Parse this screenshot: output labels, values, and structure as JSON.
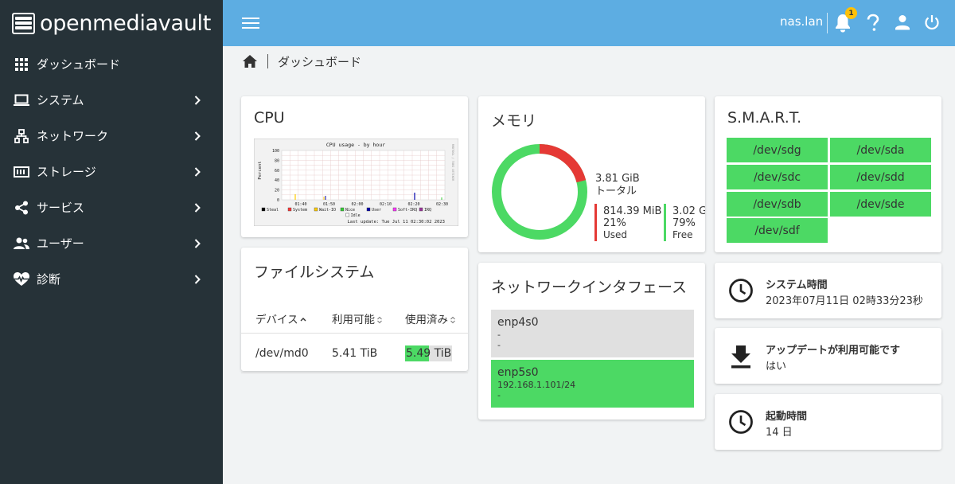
{
  "brand": {
    "name": "openmediavault"
  },
  "sidebar": {
    "items": [
      {
        "label": "ダッシュボード",
        "icon": "grid-icon"
      },
      {
        "label": "システム",
        "icon": "laptop-icon"
      },
      {
        "label": "ネットワーク",
        "icon": "network-icon"
      },
      {
        "label": "ストレージ",
        "icon": "storage-icon"
      },
      {
        "label": "サービス",
        "icon": "share-icon"
      },
      {
        "label": "ユーザー",
        "icon": "users-icon"
      },
      {
        "label": "診断",
        "icon": "heart-pulse-icon"
      }
    ]
  },
  "header": {
    "hostname": "nas.lan",
    "notification_count": "1"
  },
  "breadcrumb": {
    "current": "ダッシュボード"
  },
  "cpu": {
    "title": "CPU",
    "graph": {
      "title": "CPU usage - by hour",
      "ylabel": "Percent",
      "y_ticks": [
        "100",
        "80",
        "60",
        "40",
        "20",
        "0"
      ],
      "x_ticks": [
        "01:40",
        "01:50",
        "02:00",
        "02:10",
        "02:20",
        "02:30"
      ],
      "legend": [
        "Steal",
        "System",
        "Wait-IO",
        "Nice",
        "User",
        "Soft-IRQ",
        "IRQ",
        "Idle"
      ],
      "legend_colors": [
        "#000000",
        "#ff3333",
        "#ffcc00",
        "#33cc33",
        "#0000aa",
        "#ff33ff",
        "#993399",
        "#ffffff"
      ],
      "last_update": "Last update: Tue Jul 11 02:30:02 2023",
      "side_text": "RRDTOOL / TOBI OETIKER"
    }
  },
  "filesystem": {
    "title": "ファイルシステム",
    "columns": [
      "デバイス",
      "利用可能",
      "使用済み"
    ],
    "rows": [
      {
        "device": "/dev/md0",
        "available": "5.41 TiB",
        "used_value": "5.49",
        "used_unit": "TiB",
        "used_fraction": 0.5
      }
    ]
  },
  "memory": {
    "title": "メモリ",
    "total": "3.81 GiB",
    "total_label": "トータル",
    "used": "814.39 MiB",
    "used_percent": "21%",
    "used_label": "Used",
    "free": "3.02 G",
    "free_percent": "79%",
    "free_label": "Free",
    "used_fraction": 0.21,
    "used_color": "#e53935",
    "free_color": "#4cd964"
  },
  "network": {
    "title": "ネットワークインタフェース",
    "interfaces": [
      {
        "name": "enp4s0",
        "line1": "-",
        "line2": "-",
        "color": "#e0e0e0"
      },
      {
        "name": "enp5s0",
        "line1": "192.168.1.101/24",
        "line2": "-",
        "color": "#4cd964"
      }
    ]
  },
  "smart": {
    "title": "S.M.A.R.T.",
    "disks": [
      "/dev/sdg",
      "/dev/sda",
      "/dev/sdc",
      "/dev/sdd",
      "/dev/sdb",
      "/dev/sde",
      "/dev/sdf"
    ]
  },
  "system_time": {
    "title": "システム時間",
    "value": "2023年07月11日 02時33分23秒"
  },
  "updates": {
    "title": "アップデートが利用可能です",
    "value": "はい"
  },
  "uptime": {
    "title": "起動時間",
    "value": "14 日"
  }
}
